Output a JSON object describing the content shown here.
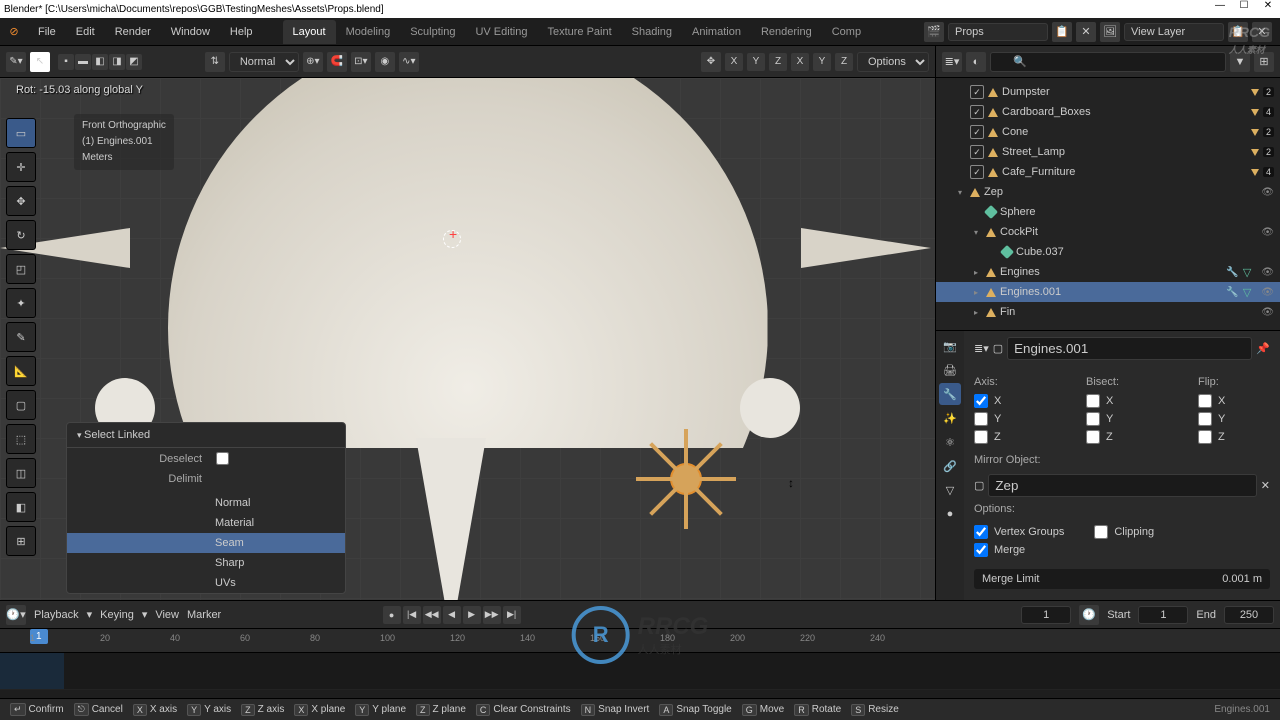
{
  "title": "Blender* [C:\\Users\\micha\\Documents\\repos\\GGB\\TestingMeshes\\Assets\\Props.blend]",
  "menu": [
    "File",
    "Edit",
    "Render",
    "Window",
    "Help"
  ],
  "tabs": [
    "Layout",
    "Modeling",
    "Sculpting",
    "UV Editing",
    "Texture Paint",
    "Shading",
    "Animation",
    "Rendering",
    "Comp"
  ],
  "active_tab": "Layout",
  "scene": {
    "name": "Props",
    "layer": "View Layer"
  },
  "tool_header": {
    "orientation": "Normal",
    "options": "Options",
    "gizmo_axes": [
      "X",
      "Y",
      "Z"
    ],
    "overlay_axes": [
      "X",
      "Y",
      "Z"
    ]
  },
  "viewport": {
    "status": "Rot: -15.03 along global Y",
    "view_name": "Front Orthographic",
    "object_label": "(1) Engines.001",
    "units": "Meters"
  },
  "popup": {
    "title": "Select Linked",
    "deselect_label": "Deselect",
    "delimit_label": "Delimit",
    "options": [
      "Normal",
      "Material",
      "Seam",
      "Sharp",
      "UVs"
    ],
    "active": "Seam"
  },
  "outliner": {
    "search": "",
    "rows": [
      {
        "name": "Dumpster",
        "type": "obj",
        "count": "2",
        "indent": 1,
        "chk": true
      },
      {
        "name": "Cardboard_Boxes",
        "type": "obj",
        "count": "4",
        "indent": 1,
        "chk": true
      },
      {
        "name": "Cone",
        "type": "obj",
        "count": "2",
        "indent": 1,
        "chk": true
      },
      {
        "name": "Street_Lamp",
        "type": "obj",
        "count": "2",
        "indent": 1,
        "chk": true
      },
      {
        "name": "Cafe_Furniture",
        "type": "obj",
        "count": "4",
        "indent": 1,
        "chk": true
      },
      {
        "name": "Zep",
        "type": "obj",
        "indent": 1,
        "chev": "down",
        "eye": true
      },
      {
        "name": "Sphere",
        "type": "mesh",
        "indent": 2
      },
      {
        "name": "CockPit",
        "type": "obj",
        "indent": 2,
        "chev": "down",
        "eye": true
      },
      {
        "name": "Cube.037",
        "type": "mesh",
        "indent": 3
      },
      {
        "name": "Engines",
        "type": "obj",
        "indent": 2,
        "chev": "right",
        "mod": true,
        "eye": true
      },
      {
        "name": "Engines.001",
        "type": "obj",
        "indent": 2,
        "chev": "right",
        "sel": true,
        "mod": true,
        "eye": true
      },
      {
        "name": "Fin",
        "type": "obj",
        "indent": 2,
        "chev": "right",
        "eye": true
      }
    ]
  },
  "props": {
    "object_name": "Engines.001",
    "axis_label": "Axis:",
    "bisect_label": "Bisect:",
    "flip_label": "Flip:",
    "axes": [
      "X",
      "Y",
      "Z"
    ],
    "axis_state": {
      "X": true,
      "Y": false,
      "Z": false
    },
    "mirror_label": "Mirror Object:",
    "mirror_value": "Zep",
    "options_label": "Options:",
    "vertex_groups": "Vertex Groups",
    "clipping": "Clipping",
    "merge": "Merge",
    "merge_limit_label": "Merge Limit",
    "merge_limit": "0.001 m"
  },
  "timeline": {
    "menus": [
      "Playback",
      "Keying",
      "View",
      "Marker"
    ],
    "current": "1",
    "start_label": "Start",
    "start": "1",
    "end_label": "End",
    "end": "250",
    "ticks": [
      "1",
      "20",
      "40",
      "60",
      "80",
      "100",
      "120",
      "140",
      "160",
      "180",
      "200",
      "220",
      "240"
    ]
  },
  "statusbar": {
    "confirm": "Confirm",
    "cancel": "Cancel",
    "items": [
      {
        "k": "X",
        "l": "X axis"
      },
      {
        "k": "Y",
        "l": "Y axis"
      },
      {
        "k": "Z",
        "l": "Z axis"
      },
      {
        "k": "X",
        "l": "X plane"
      },
      {
        "k": "Y",
        "l": "Y plane"
      },
      {
        "k": "Z",
        "l": "Z plane"
      },
      {
        "k": "C",
        "l": "Clear Constraints"
      },
      {
        "k": "N",
        "l": "Snap Invert"
      },
      {
        "k": "A",
        "l": "Snap Toggle"
      },
      {
        "k": "G",
        "l": "Move"
      },
      {
        "k": "R",
        "l": "Rotate"
      },
      {
        "k": "S",
        "l": "Resize"
      }
    ],
    "right": "Engines.001"
  },
  "watermark": {
    "main": "RRCG",
    "sub": "人人素材"
  }
}
